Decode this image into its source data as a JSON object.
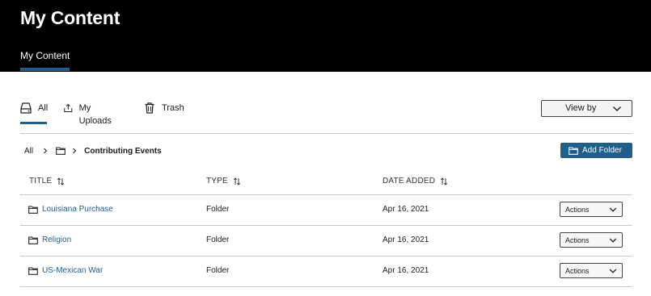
{
  "header": {
    "title": "My Content",
    "tab_label": "My Content"
  },
  "subtabs": {
    "all": "All",
    "uploads": "My Uploads",
    "trash": "Trash"
  },
  "view_by": {
    "label": "View by"
  },
  "breadcrumb": {
    "root": "All",
    "current": "Contributing Events"
  },
  "add_folder_label": "Add Folder",
  "table": {
    "headers": {
      "title": "TITLE",
      "type": "TYPE",
      "date_added": "DATE ADDED"
    },
    "rows": [
      {
        "title": "Louisiana Purchase",
        "type": "Folder",
        "date_added": "Apr 16, 2021",
        "actions_label": "Actions"
      },
      {
        "title": "Religion",
        "type": "Folder",
        "date_added": "Apr 16, 2021",
        "actions_label": "Actions"
      },
      {
        "title": "US-Mexican War",
        "type": "Folder",
        "date_added": "Apr 16, 2021",
        "actions_label": "Actions"
      }
    ]
  },
  "colors": {
    "header_bg": "#000000",
    "accent": "#1f5f8b",
    "link": "#1f5f8b",
    "divider": "#c8c8c8"
  },
  "icons": {
    "all": "drive-icon",
    "uploads": "upload-icon",
    "trash": "trash-icon",
    "folder": "folder-icon",
    "chevron": "chevron-down-icon",
    "sort": "sort-icon",
    "breadcrumb_separator": "chevron-right-icon"
  }
}
